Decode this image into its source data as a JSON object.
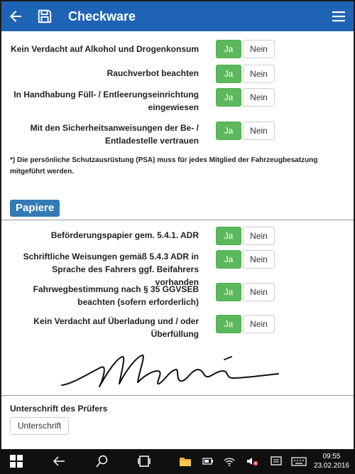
{
  "app": {
    "title": "Checkware"
  },
  "checks_top": [
    {
      "label": "Kein Verdacht auf Alkohol und Drogenkonsum",
      "yes": "Ja",
      "no": "Nein"
    },
    {
      "label": "Rauchverbot beachten",
      "yes": "Ja",
      "no": "Nein"
    },
    {
      "label": "In Handhabung Füll- / Entleerungseinrichtung eingewiesen",
      "yes": "Ja",
      "no": "Nein"
    },
    {
      "label": "Mit den Sicherheitsanweisungen der Be- / Entladestelle vertrauen",
      "yes": "Ja",
      "no": "Nein"
    }
  ],
  "note": "*) Die persönliche Schutzausrüstung (PSA) muss für jedes Mitglied der Fahrzeugbesatzung mitgeführt werden.",
  "section": {
    "title": "Papiere"
  },
  "checks_papers": [
    {
      "label": "Beförderungspapier gem. 5.4.1. ADR",
      "yes": "Ja",
      "no": "Nein"
    },
    {
      "label": "Schriftliche Weisungen gemäß 5.4.3 ADR in Sprache des Fahrers ggf. Beifahrers vorhanden",
      "yes": "Ja",
      "no": "Nein"
    },
    {
      "label": "Fahrwegbestimmung nach § 35 GGVSEB beachten (sofern erforderlich)",
      "yes": "Ja",
      "no": "Nein"
    },
    {
      "label": "Kein Verdacht auf Überladung und / oder Überfüllung",
      "yes": "Ja",
      "no": "Nein"
    }
  ],
  "signature": {
    "label": "Unterschrift des Prüfers",
    "button": "Unterschrift"
  },
  "taskbar": {
    "time": "09:55",
    "date": "23.02.2016"
  },
  "colors": {
    "appbar": "#1f63b5",
    "yes_button": "#5cb85c",
    "section_badge": "#337ab7",
    "taskbar": "#101010"
  },
  "icons": [
    "back-arrow-icon",
    "save-icon",
    "hamburger-menu-icon",
    "windows-start-icon",
    "taskbar-back-icon",
    "search-icon",
    "task-view-icon",
    "file-explorer-icon",
    "battery-icon",
    "wifi-icon",
    "speaker-muted-icon",
    "notification-icon",
    "keyboard-icon"
  ]
}
